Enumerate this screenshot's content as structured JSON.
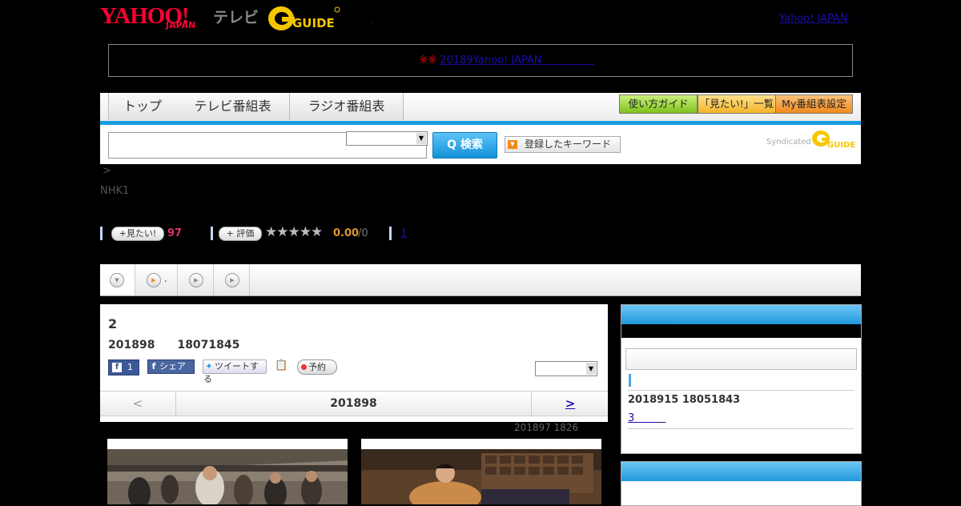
{
  "header": {
    "logo_yahoo": "YAHOO!",
    "logo_japan": "JAPAN",
    "logo_tv": "テレビ",
    "logo_gguide": "G GUIDE",
    "link": "Yahoo! JAPAN",
    "dot": ".",
    "dot2": ","
  },
  "notice": {
    "mark": "※※ ",
    "link": "20189Yahoo! JAPAN　　　　　"
  },
  "nav": {
    "tabs": [
      "トップ",
      "テレビ番組表",
      "ラジオ番組表"
    ],
    "buttons": [
      "使い方ガイド",
      "「見たい!」一覧",
      "My番組表設定"
    ]
  },
  "search": {
    "button": "Q 検索",
    "keyword_button": "登録したキーワード",
    "syndicated": "Syndicated",
    "syndicated_logo": "GUIDE"
  },
  "breadcrumb": {
    "arrow": ">",
    "channel": "NHK1"
  },
  "stats": {
    "want_label": "+見たい!",
    "want_count": "97",
    "rate_label": "+ 評価",
    "stars": "★★★★★",
    "score": "0.00",
    "total": "/0",
    "link_count": "1"
  },
  "tabs": {
    "items": [
      {
        "icon": "chevron-down-icon",
        "label": ""
      },
      {
        "icon": "play-icon",
        "label": "."
      },
      {
        "icon": "play-icon",
        "label": ""
      },
      {
        "icon": "play-icon",
        "label": ""
      }
    ]
  },
  "program": {
    "title": "2",
    "datetime": "201898　　18071845",
    "fb_like": "1",
    "fb_share": "シェア",
    "tweet": "ツイートする",
    "reserve": "予約"
  },
  "date_nav": {
    "prev": "<",
    "current": "201898",
    "next": ">"
  },
  "updated": "201897  1826",
  "right": {
    "date": "2018915  18051843",
    "link": "3　　　"
  },
  "colors": {
    "accent": "#1a9be0",
    "brand_red": "#ff0033",
    "link": "#1a0dab"
  }
}
